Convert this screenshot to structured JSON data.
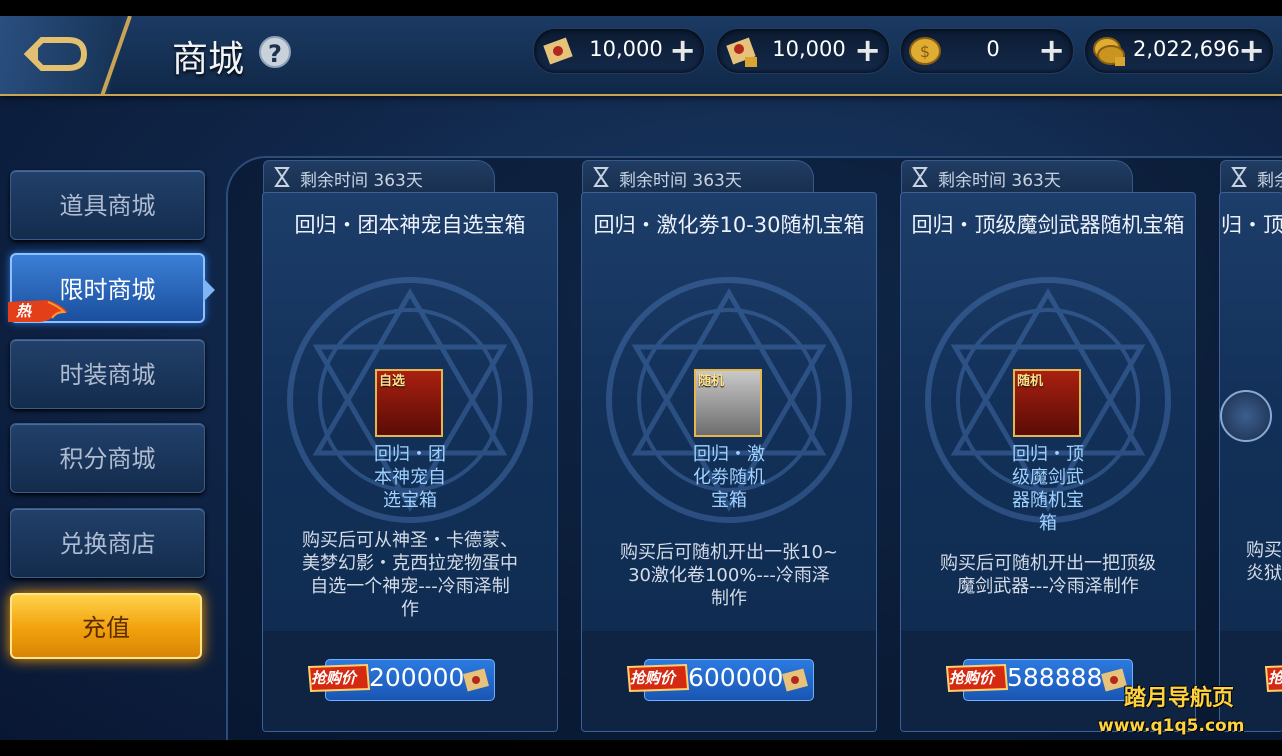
{
  "header": {
    "title": "商城",
    "help_label": "?",
    "currencies": [
      {
        "icon": "scroll-icon",
        "value": "10,000"
      },
      {
        "icon": "locked-scroll-icon",
        "value": "10,000"
      },
      {
        "icon": "gold-coin-icon",
        "value": "0"
      },
      {
        "icon": "locked-gold-coins-icon",
        "value": "2,022,696"
      }
    ]
  },
  "sidebar": {
    "items": [
      {
        "label": "道具商城"
      },
      {
        "label": "限时商城",
        "badge": "热"
      },
      {
        "label": "时装商城"
      },
      {
        "label": "积分商城"
      },
      {
        "label": "兑换商店"
      }
    ],
    "recharge_label": "充值"
  },
  "cards": [
    {
      "timer_label": "剩余时间",
      "timer_value": "363天",
      "title": "回归・团本神宠自选宝箱",
      "item_tag": "自选",
      "item_name": [
        "回归・团",
        "本神宠自",
        "选宝箱"
      ],
      "description": [
        "购买后可从神圣・卡德蒙、",
        "美梦幻影・克西拉宠物蛋中",
        "自选一个神宠---冷雨泽制",
        "作"
      ],
      "price_tag": "抢购价",
      "price": "200000"
    },
    {
      "timer_label": "剩余时间",
      "timer_value": "363天",
      "title": "回归・激化劵10-30随机宝箱",
      "item_tag": "随机",
      "item_name": [
        "回归・激",
        "化劵随机",
        "宝箱"
      ],
      "description": [
        "购买后可随机开出一张10~",
        "30激化卷100%---冷雨泽",
        "制作"
      ],
      "price_tag": "抢购价",
      "price": "600000"
    },
    {
      "timer_label": "剩余时间",
      "timer_value": "363天",
      "title": "回归・顶级魔剑武器随机宝箱",
      "item_tag": "随机",
      "item_name": [
        "回归・顶",
        "级魔剑武",
        "器随机宝",
        "箱"
      ],
      "description": [
        "购买后可随机开出一把顶级",
        "魔剑武器---冷雨泽制作"
      ],
      "price_tag": "抢购价",
      "price": "588888"
    }
  ],
  "partial_card": {
    "timer_label": "剩余",
    "title": "回归・顶",
    "description": [
      "购买",
      "炎狱"
    ],
    "price_tag": "抢"
  },
  "watermark": {
    "line1": "踏月导航页",
    "line2": "www.q1q5.com"
  }
}
